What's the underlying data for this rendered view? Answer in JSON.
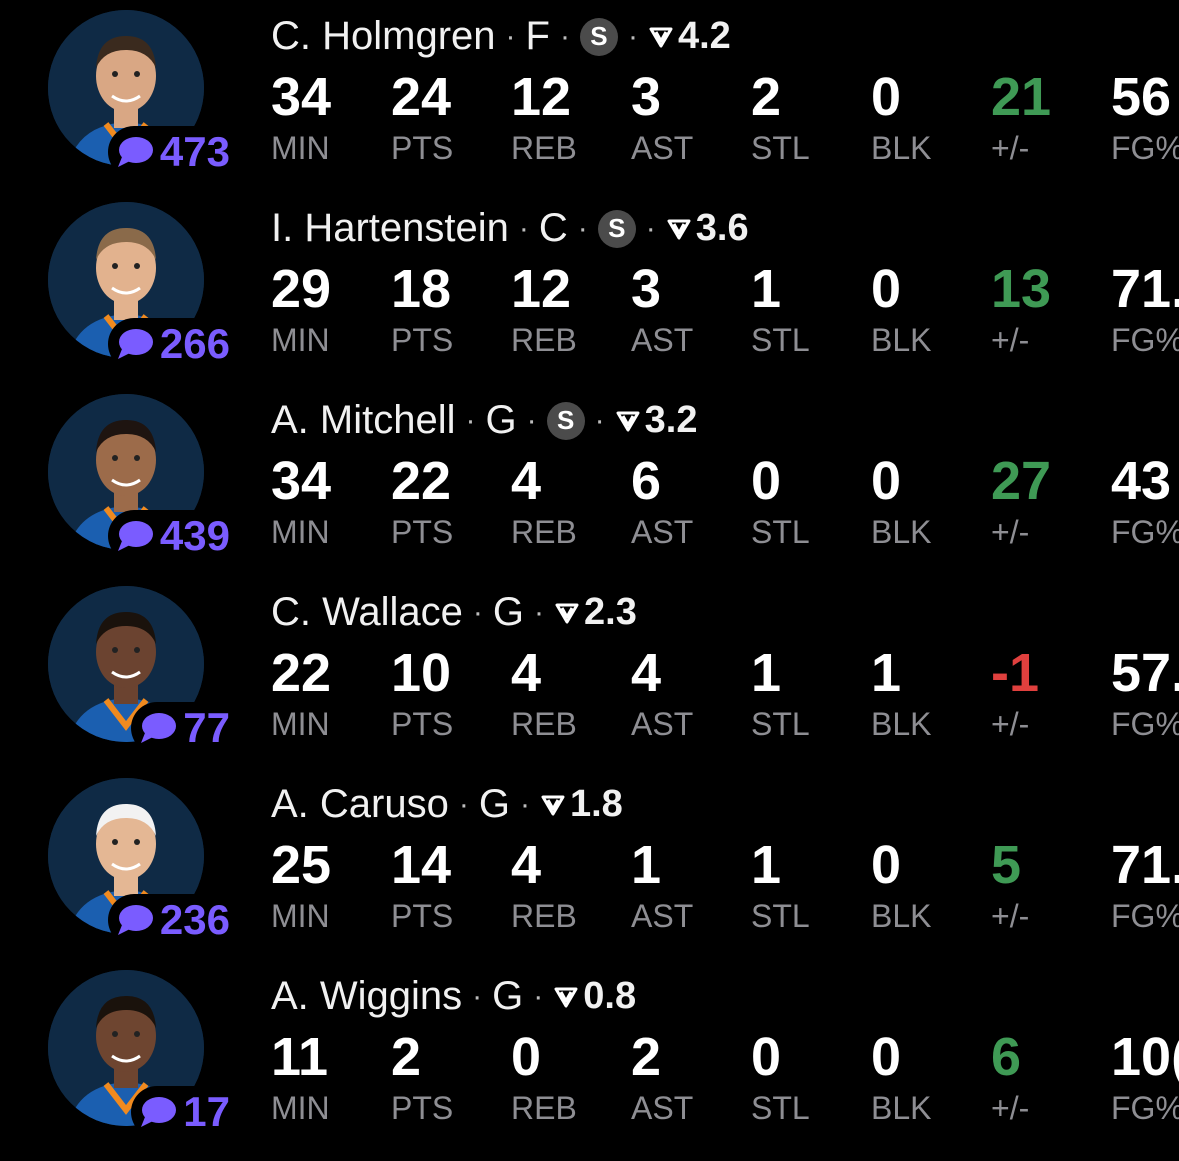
{
  "labels": [
    "MIN",
    "PTS",
    "REB",
    "AST",
    "STL",
    "BLK",
    "+/-",
    "FG%"
  ],
  "colors": {
    "accent_comments": "#7a5cff",
    "positive": "#3f9a55",
    "negative": "#e0403e",
    "label_gray": "#8e8e93"
  },
  "players": [
    {
      "name": "C. Holmgren",
      "pos": "F",
      "starter": true,
      "starter_badge": "S",
      "rating": "4.2",
      "comments": "473",
      "stats": [
        "34",
        "24",
        "12",
        "3",
        "2",
        "0",
        "21",
        "56"
      ],
      "pm_sign": "pos",
      "jersey": "#1b5fb0",
      "skin": "#d9a784",
      "hair": "#3a2a1e"
    },
    {
      "name": "I. Hartenstein",
      "pos": "C",
      "starter": true,
      "starter_badge": "S",
      "rating": "3.6",
      "comments": "266",
      "stats": [
        "29",
        "18",
        "12",
        "3",
        "1",
        "0",
        "13",
        "71."
      ],
      "pm_sign": "pos",
      "jersey": "#1b5fb0",
      "skin": "#e2b28e",
      "hair": "#8a6a4a"
    },
    {
      "name": "A. Mitchell",
      "pos": "G",
      "starter": true,
      "starter_badge": "S",
      "rating": "3.2",
      "comments": "439",
      "stats": [
        "34",
        "22",
        "4",
        "6",
        "0",
        "0",
        "27",
        "43"
      ],
      "pm_sign": "pos",
      "jersey": "#1b5fb0",
      "skin": "#9c6b4a",
      "hair": "#1e1410"
    },
    {
      "name": "C. Wallace",
      "pos": "G",
      "starter": false,
      "starter_badge": "",
      "rating": "2.3",
      "comments": "77",
      "stats": [
        "22",
        "10",
        "4",
        "4",
        "1",
        "1",
        "-1",
        "57."
      ],
      "pm_sign": "neg",
      "jersey": "#1b5fb0",
      "skin": "#6b4330",
      "hair": "#1a120c"
    },
    {
      "name": "A. Caruso",
      "pos": "G",
      "starter": false,
      "starter_badge": "",
      "rating": "1.8",
      "comments": "236",
      "stats": [
        "25",
        "14",
        "4",
        "1",
        "1",
        "0",
        "5",
        "71."
      ],
      "pm_sign": "pos",
      "jersey": "#1b5fb0",
      "skin": "#e4b794",
      "hair": "#f2f2f2"
    },
    {
      "name": "A. Wiggins",
      "pos": "G",
      "starter": false,
      "starter_badge": "",
      "rating": "0.8",
      "comments": "17",
      "stats": [
        "11",
        "2",
        "0",
        "2",
        "0",
        "0",
        "6",
        "10("
      ],
      "pm_sign": "pos",
      "jersey": "#1b5fb0",
      "skin": "#6e4530",
      "hair": "#1a120c"
    }
  ]
}
